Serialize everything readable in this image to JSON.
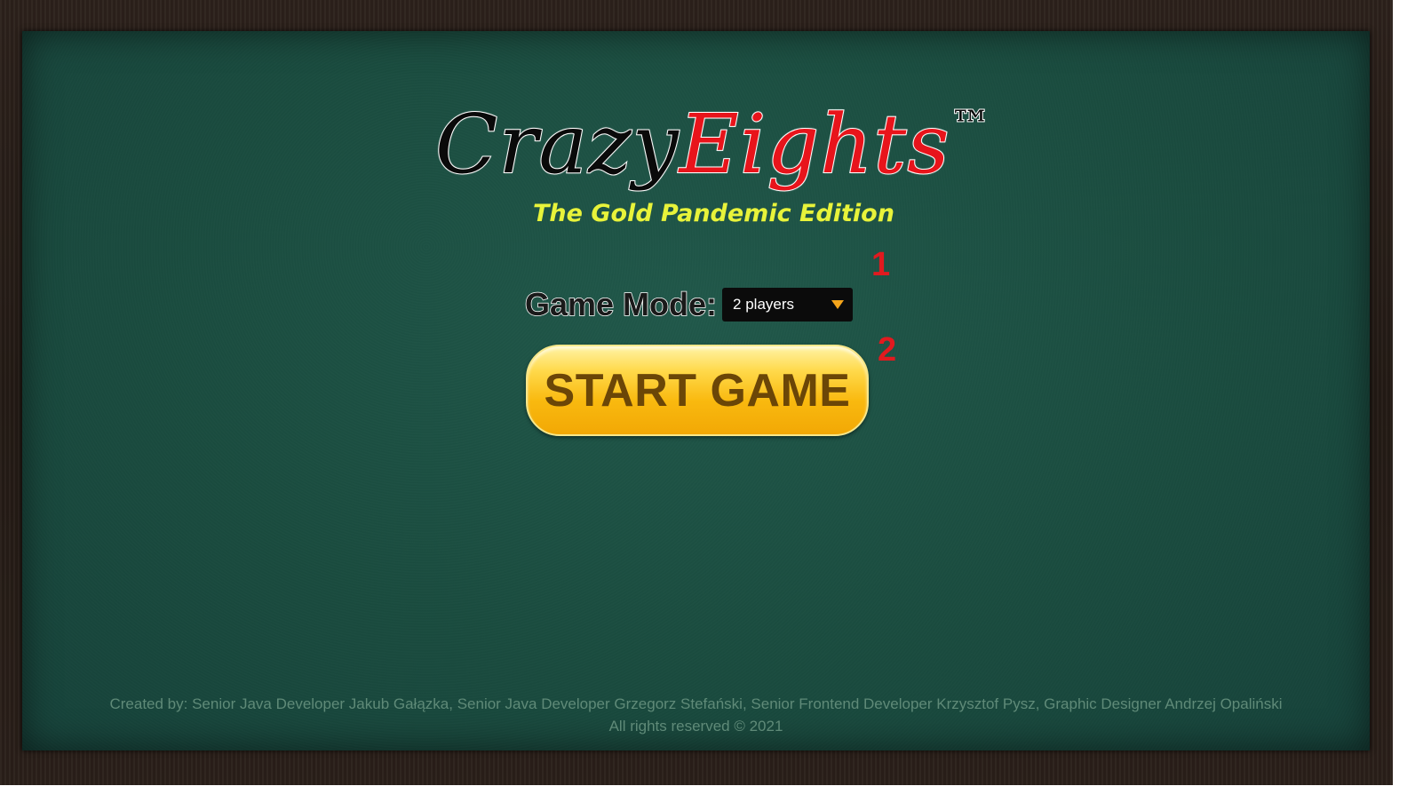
{
  "logo": {
    "part1": "Crazy",
    "part2": "Eights",
    "trademark": "™"
  },
  "subtitle": "The Gold Pandemic Edition",
  "annotations": {
    "marker1": "1",
    "marker2": "2"
  },
  "game_mode": {
    "label": "Game Mode:",
    "selected": "2 players"
  },
  "start_button": {
    "label": "START GAME"
  },
  "footer": {
    "credits": "Created by: Senior Java Developer Jakub Gałązka, Senior Java Developer Grzegorz Stefański, Senior Frontend Developer Krzysztof Pysz, Graphic Designer Andrzej Opaliński",
    "rights": "All rights reserved © 2021"
  },
  "colors": {
    "felt": "#1a4c3f",
    "frame": "#2a1f19",
    "logo_red": "#e8141b",
    "subtitle_yellow": "#e8f33a",
    "button_gold": "#f9b90f",
    "marker_red": "#e11a1f"
  },
  "icons": {
    "dropdown": "caret-down-icon"
  }
}
